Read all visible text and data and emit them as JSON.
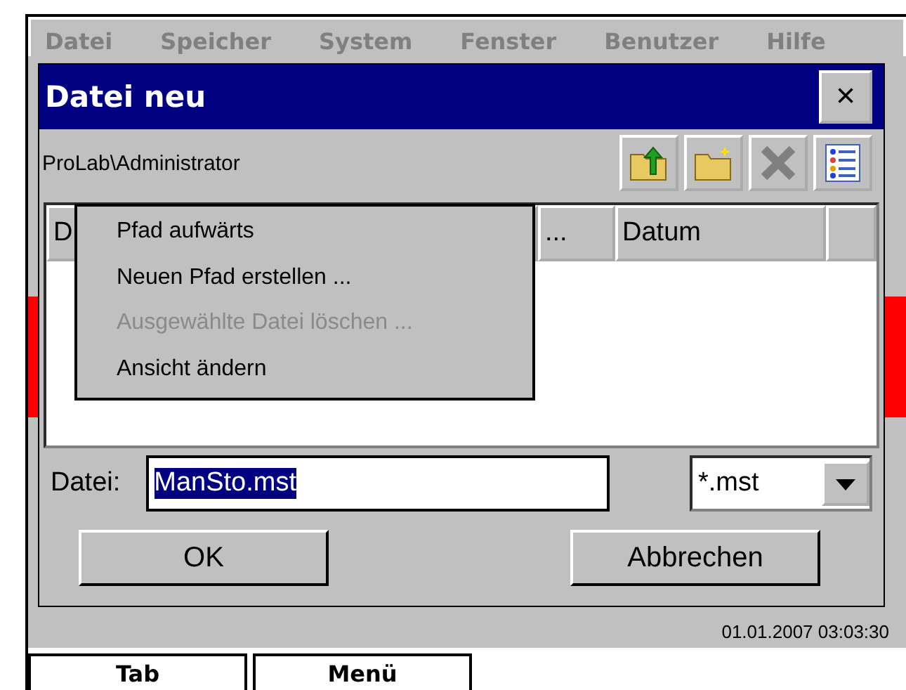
{
  "app_menu": [
    "Datei",
    "Speicher",
    "System",
    "Fenster",
    "Benutzer",
    "Hilfe"
  ],
  "dialog": {
    "title": "Datei neu",
    "close": "×",
    "path": "ProLab\\Administrator",
    "toolbar": [
      {
        "kind": "up",
        "disabled": false
      },
      {
        "kind": "newfolder",
        "disabled": false
      },
      {
        "kind": "delete",
        "disabled": true
      },
      {
        "kind": "view",
        "disabled": false
      }
    ],
    "columns": [
      "D",
      "...",
      "Datum",
      ""
    ],
    "file_label": "Datei:",
    "file_value": "ManSto.mst",
    "filter": "*.mst",
    "buttons": [
      {
        "label": "OK"
      },
      {
        "label": "Abbrechen"
      }
    ]
  },
  "context_menu": [
    {
      "label": "Pfad aufwärts",
      "disabled": false
    },
    {
      "label": "Neuen Pfad erstellen ...",
      "disabled": false
    },
    {
      "label": "Ausgewählte Datei löschen ...",
      "disabled": true
    },
    {
      "label": "Ansicht ändern",
      "disabled": false
    }
  ],
  "status_bar": {
    "datetime": "01.01.2007 03:03:30"
  },
  "bottom_tabs": [
    "Tab",
    "Menü"
  ]
}
